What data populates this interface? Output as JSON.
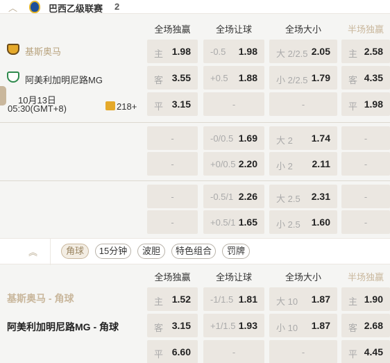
{
  "league": {
    "name": "巴西乙级联赛",
    "count": "2",
    "collapse_icon": "chevron-up-icon"
  },
  "headers": {
    "h1": "全场独赢",
    "h2": "全场让球",
    "h3": "全场大小",
    "h4": "半场独赢"
  },
  "match": {
    "home": "基斯奥马",
    "away": "阿美利加明尼路MG",
    "date": "10月13日",
    "time": "05:30(GMT+8)",
    "markets": "218+"
  },
  "odds": {
    "r1": {
      "ml_lbl": "主",
      "ml_val": "1.98",
      "hc_lbl": "-0.5",
      "hc_val": "1.98",
      "ou_lbl": "大 2/2.5",
      "ou_val": "2.05",
      "ht_lbl": "主",
      "ht_val": "2.58"
    },
    "r2": {
      "ml_lbl": "客",
      "ml_val": "3.55",
      "hc_lbl": "+0.5",
      "hc_val": "1.88",
      "ou_lbl": "小 2/2.5",
      "ou_val": "1.79",
      "ht_lbl": "客",
      "ht_val": "4.35"
    },
    "r3": {
      "ml_lbl": "平",
      "ml_val": "3.15",
      "hc_dash": "-",
      "ou_dash": "-",
      "ht_lbl": "平",
      "ht_val": "1.98"
    },
    "r4": {
      "ml_dash": "-",
      "hc_lbl": "-0/0.5",
      "hc_val": "1.69",
      "ou_lbl": "大 2",
      "ou_val": "1.74",
      "ht_dash": "-"
    },
    "r5": {
      "ml_dash": "-",
      "hc_lbl": "+0/0.5",
      "hc_val": "2.20",
      "ou_lbl": "小 2",
      "ou_val": "2.11",
      "ht_dash": "-"
    },
    "r6": {
      "ml_dash": "-",
      "hc_lbl": "-0.5/1",
      "hc_val": "2.26",
      "ou_lbl": "大 2.5",
      "ou_val": "2.31",
      "ht_dash": "-"
    },
    "r7": {
      "ml_dash": "-",
      "hc_lbl": "+0.5/1",
      "hc_val": "1.65",
      "ou_lbl": "小 2.5",
      "ou_val": "1.60",
      "ht_dash": "-"
    }
  },
  "filters": {
    "up_icon": "double-chevron-up-icon",
    "f1": "角球",
    "f2": "15分钟",
    "f3": "波胆",
    "f4": "特色组合",
    "f5": "罚牌"
  },
  "corners": {
    "home": "基斯奥马 - 角球",
    "away": "阿美利加明尼路MG - 角球",
    "r1": {
      "ml_lbl": "主",
      "ml_val": "1.52",
      "hc_lbl": "-1/1.5",
      "hc_val": "1.81",
      "ou_lbl": "大 10",
      "ou_val": "1.87",
      "ht_lbl": "主",
      "ht_val": "1.90"
    },
    "r2": {
      "ml_lbl": "客",
      "ml_val": "3.15",
      "hc_lbl": "+1/1.5",
      "hc_val": "1.93",
      "ou_lbl": "小 10",
      "ou_val": "1.87",
      "ht_lbl": "客",
      "ht_val": "2.68"
    },
    "r3": {
      "ml_lbl": "平",
      "ml_val": "6.60",
      "hc_dash": "-",
      "ou_dash": "-",
      "ht_lbl": "平",
      "ht_val": "4.45"
    }
  }
}
